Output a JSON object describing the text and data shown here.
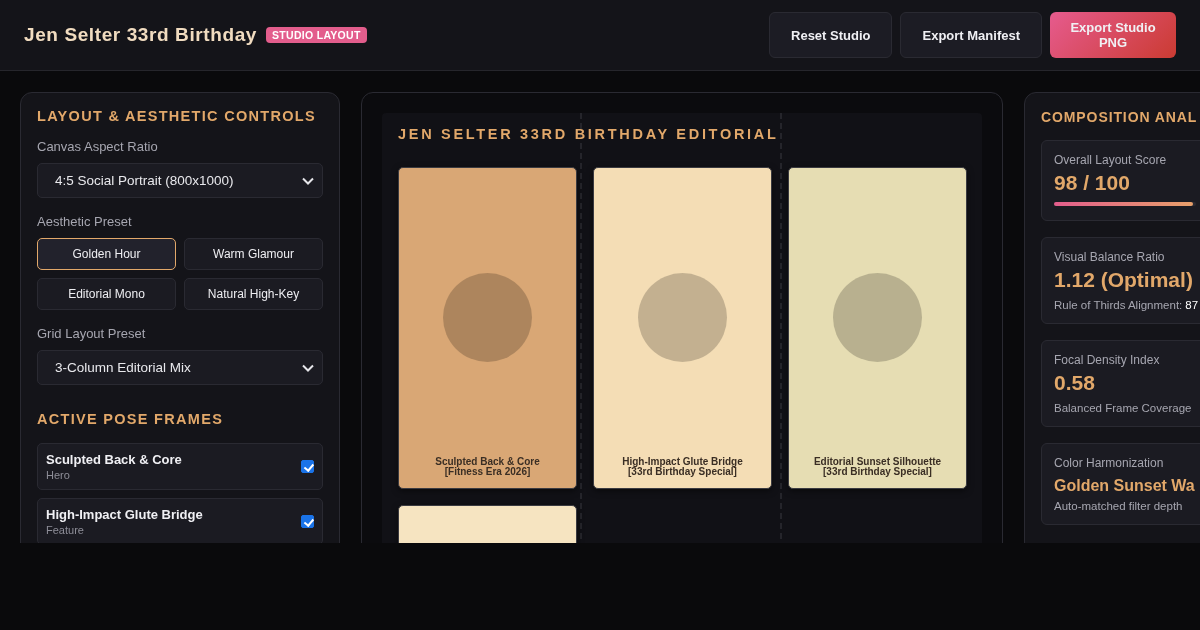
{
  "header": {
    "title": "Jen Selter 33rd Birthday",
    "badge": "STUDIO LAYOUT",
    "buttons": [
      {
        "label": "Reset Studio",
        "kind": "plain"
      },
      {
        "label": "Export Manifest",
        "kind": "plain"
      },
      {
        "label": "Export Studio PNG",
        "kind": "primary"
      }
    ]
  },
  "controls": {
    "title": "LAYOUT & AESTHETIC CONTROLS",
    "aspect": {
      "label": "Canvas Aspect Ratio",
      "value": "4:5 Social Portrait (800x1000)"
    },
    "presets": {
      "label": "Aesthetic Preset",
      "items": [
        {
          "label": "Golden Hour",
          "selected": true
        },
        {
          "label": "Warm Glamour",
          "selected": false
        },
        {
          "label": "Editorial Mono",
          "selected": false
        },
        {
          "label": "Natural High-Key",
          "selected": false
        }
      ]
    },
    "grid": {
      "label": "Grid Layout Preset",
      "value": "3-Column Editorial Mix"
    },
    "poses_title": "ACTIVE POSE FRAMES",
    "poses": [
      {
        "name": "Sculpted Back & Core",
        "role": "Hero",
        "checked": true
      },
      {
        "name": "High-Impact Glute Bridge",
        "role": "Feature",
        "checked": true
      }
    ]
  },
  "canvas": {
    "title": "JEN SELTER 33RD BIRTHDAY EDITORIAL",
    "frames": [
      {
        "color": "#d9a775",
        "caption": [
          "Sculpted Back & Core",
          "[Fitness Era 2026]"
        ]
      },
      {
        "color": "#f4ddb5",
        "caption": [
          "High-Impact Glute Bridge",
          "[33rd Birthday Special]"
        ]
      },
      {
        "color": "#e6ddb3",
        "caption": [
          "Editorial Sunset Silhouette",
          "[33rd Birthday Special]"
        ]
      },
      {
        "color": "#f6e4c1"
      }
    ]
  },
  "analysis": {
    "title": "COMPOSITION ANAL",
    "cards": [
      {
        "kind": "score",
        "label": "Overall Layout Score",
        "value": "98 / 100",
        "level": 0.98
      },
      {
        "kind": "note",
        "label": "Visual Balance Ratio",
        "value": "1.12 (Optimal)",
        "note": "Rule of Thirds Alignment:",
        "note_value": "87"
      },
      {
        "kind": "note",
        "label": "Focal Density Index",
        "value": "0.58",
        "note": "Balanced Frame Coverage"
      },
      {
        "kind": "note",
        "label": "Color Harmonization",
        "value": "Golden Sunset Wa",
        "note": "Auto-matched filter depth"
      }
    ]
  }
}
